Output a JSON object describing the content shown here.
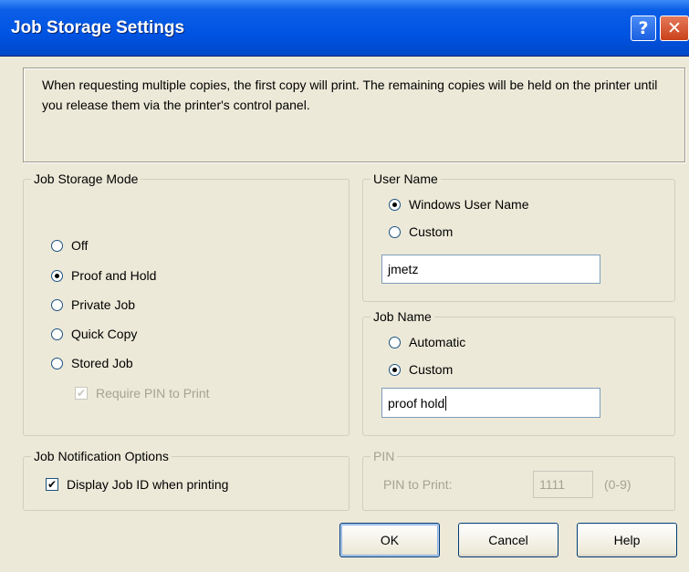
{
  "window": {
    "title": "Job Storage Settings",
    "help_glyph": "?",
    "close_glyph": "✕"
  },
  "message": "When requesting multiple copies, the first copy will print. The remaining copies will be held on the printer until you release them via the printer's control panel.",
  "storage_mode": {
    "legend": "Job Storage Mode",
    "options": [
      "Off",
      "Proof and Hold",
      "Private Job",
      "Quick Copy",
      "Stored Job"
    ],
    "selected": "Proof and Hold",
    "require_pin_label": "Require PIN to Print",
    "require_pin_checked": true
  },
  "user_name": {
    "legend": "User Name",
    "options": [
      "Windows User Name",
      "Custom"
    ],
    "selected": "Windows User Name",
    "value": "jmetz"
  },
  "job_name": {
    "legend": "Job Name",
    "options": [
      "Automatic",
      "Custom"
    ],
    "selected": "Custom",
    "value": "proof hold"
  },
  "notification": {
    "legend": "Job Notification Options",
    "display_job_id_label": "Display Job ID when printing",
    "display_job_id_checked": true
  },
  "pin": {
    "legend": "PIN",
    "label": "PIN to Print:",
    "value": "1111",
    "range_hint": "(0-9)"
  },
  "buttons": {
    "ok": "OK",
    "cancel": "Cancel",
    "help": "Help"
  }
}
